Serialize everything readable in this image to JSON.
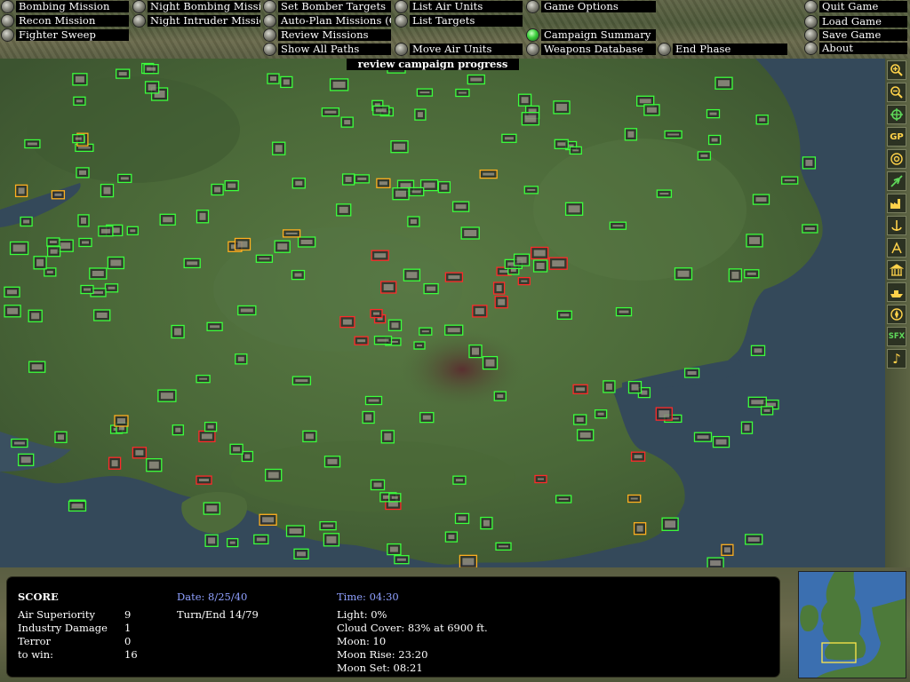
{
  "menu": {
    "bombing_mission": "Bombing Mission",
    "recon_mission": "Recon Mission",
    "fighter_sweep": "Fighter Sweep",
    "night_bombing_mission": "Night Bombing Mission",
    "night_intruder_mission": "Night Intruder Mission",
    "set_bomber_targets": "Set Bomber Targets",
    "auto_plan_missions": "Auto-Plan Missions (Off)",
    "review_missions": "Review Missions",
    "show_all_paths": "Show All Paths",
    "list_air_units": "List Air Units",
    "list_targets": "List Targets",
    "move_air_units": "Move Air Units",
    "game_options": "Game Options",
    "campaign_summary": "Campaign Summary",
    "weapons_database": "Weapons Database",
    "end_phase": "End Phase",
    "quit_game": "Quit Game",
    "load_game": "Load Game",
    "save_game": "Save Game",
    "about": "About"
  },
  "map": {
    "tooltip": "review campaign progress"
  },
  "toolbar": [
    {
      "name": "zoom-in-icon"
    },
    {
      "name": "zoom-out-icon"
    },
    {
      "name": "crosshair-icon"
    },
    {
      "name": "gp-label",
      "text": "GP"
    },
    {
      "name": "target-icon"
    },
    {
      "name": "aircraft-icon"
    },
    {
      "name": "factory-icon"
    },
    {
      "name": "anchor-icon"
    },
    {
      "name": "radar-icon"
    },
    {
      "name": "building-icon"
    },
    {
      "name": "ship-icon"
    },
    {
      "name": "compass-icon"
    },
    {
      "name": "sfx-label",
      "text": "SFX"
    },
    {
      "name": "music-note-icon",
      "text": "♪"
    }
  ],
  "score": {
    "title": "SCORE",
    "rows": [
      {
        "label": "Air Superiority",
        "value": "9"
      },
      {
        "label": "Industry Damage",
        "value": "1"
      },
      {
        "label": "Terror",
        "value": "0"
      },
      {
        "label": "to win:",
        "value": "16"
      }
    ]
  },
  "date": {
    "label": "Date: 8/25/40",
    "turn": "Turn/End 14/79"
  },
  "time": {
    "label": "Time: 04:30",
    "light": "Light: 0%",
    "cloud_cover": "Cloud Cover: 83% at 6900 ft.",
    "moon": "Moon: 10",
    "moon_rise": "Moon Rise: 23:20",
    "moon_set": "Moon Set: 08:21"
  },
  "colors": {
    "friendly_unit": "#3cff3c",
    "enemy_unit": "#ff2a2a",
    "neutral_unit": "#ffb020",
    "info_blue": "#8fa0ff",
    "sea": "#35495a",
    "land": "#4c6a3a"
  }
}
